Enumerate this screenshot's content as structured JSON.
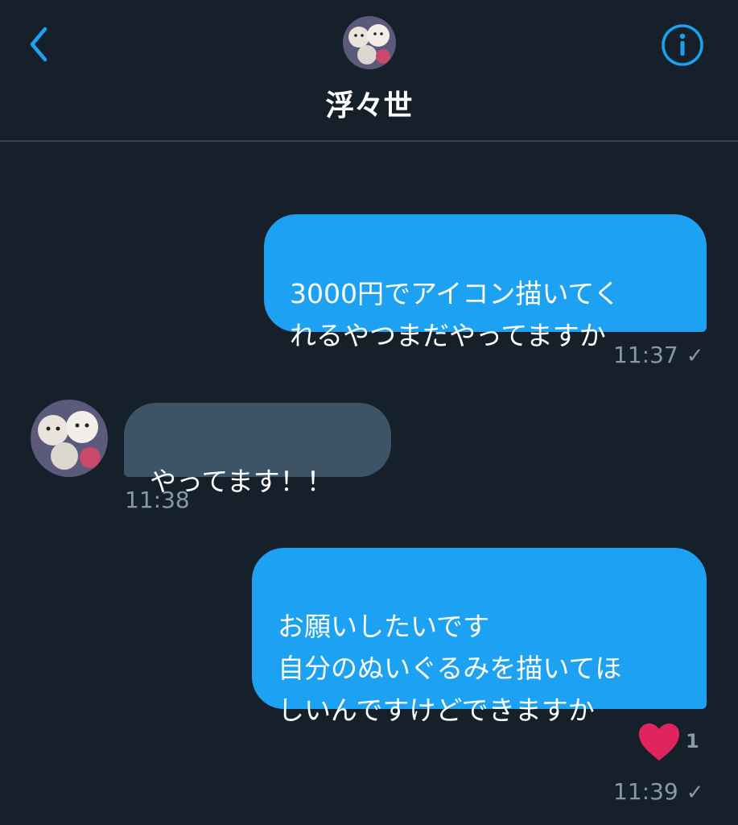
{
  "header": {
    "contact_name": "浮々世"
  },
  "messages": [
    {
      "direction": "outgoing",
      "text": "3000円でアイコン描いてく\nれるやつまだやってますか",
      "time": "11:37",
      "status_icon": "check-icon"
    },
    {
      "direction": "incoming",
      "text": "やってます！！",
      "time": "11:38"
    },
    {
      "direction": "outgoing",
      "text": "お願いしたいです\n自分のぬいぐるみを描いてほ\nしいんですけどできますか",
      "time": "11:39",
      "status_icon": "check-icon",
      "reaction": {
        "icon": "heart-icon",
        "count": "1"
      }
    }
  ],
  "colors": {
    "background": "#15202b",
    "outgoing_bubble": "#1da1f2",
    "incoming_bubble": "#3d5466",
    "accent": "#1da1f2",
    "muted_text": "#8899a6",
    "heart": "#e0245e"
  }
}
